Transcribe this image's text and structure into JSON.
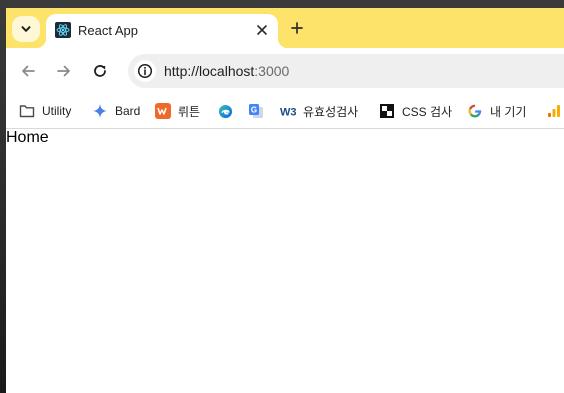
{
  "browser": {
    "tab": {
      "title": "React App"
    },
    "address": {
      "scheme_host": "http://localhost",
      "port": ":3000"
    },
    "bookmarks": [
      {
        "label": "Utility",
        "icon": "folder-icon"
      },
      {
        "label": "Bard",
        "icon": "bard-sparkle-icon"
      },
      {
        "label": "뤼튼",
        "icon": "wrtn-icon"
      },
      {
        "label": "",
        "icon": "edge-icon"
      },
      {
        "label": "",
        "icon": "google-translate-icon"
      },
      {
        "label": "유효성검사",
        "icon": "w3c-icon"
      },
      {
        "label": "CSS 검사",
        "icon": "css-validator-icon"
      },
      {
        "label": "내 기기",
        "icon": "google-icon"
      },
      {
        "label": "",
        "icon": "analytics-icon"
      }
    ]
  },
  "page": {
    "heading": "Home"
  }
}
